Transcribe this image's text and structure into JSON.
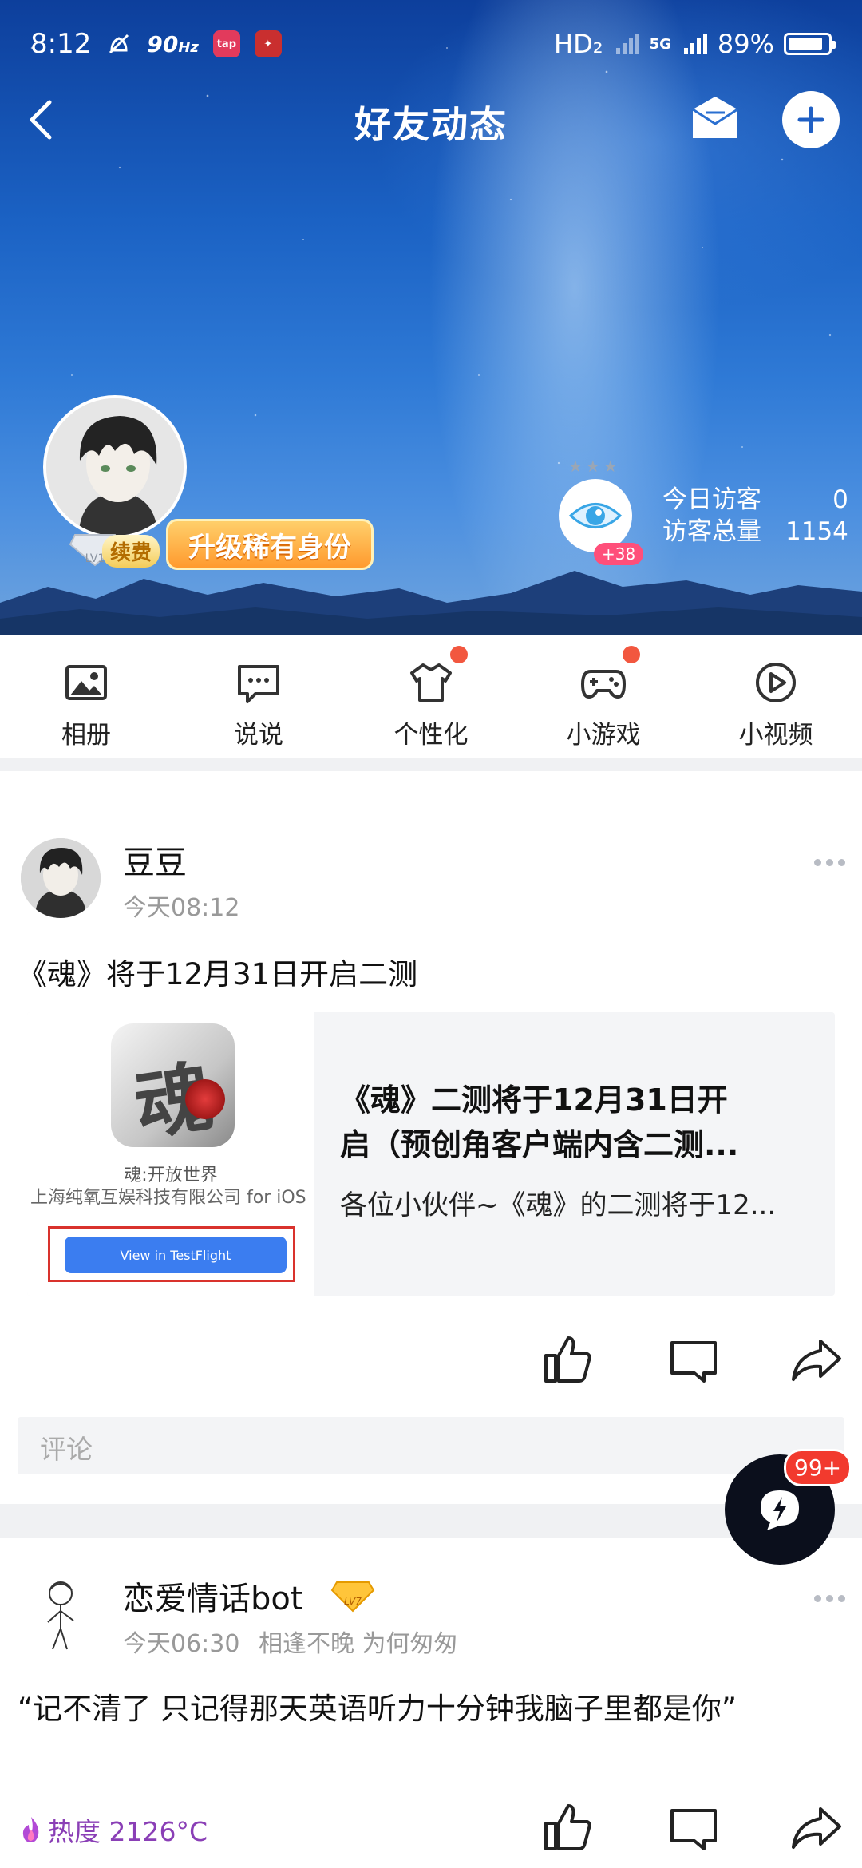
{
  "status_bar": {
    "time": "8:12",
    "refresh_rate": "90",
    "refresh_unit": "Hz",
    "network": "HD₂",
    "signal_label": "5G",
    "battery": "89%",
    "battery_level": 0.89,
    "app_icons": [
      "taptap-icon",
      "game-app-icon"
    ]
  },
  "nav": {
    "title": "好友动态",
    "icons": [
      "back-arrow-icon",
      "message-envelope-icon",
      "plus-icon"
    ]
  },
  "profile": {
    "level": "LV1",
    "renew_label": "续费",
    "upgrade_label": "升级稀有身份",
    "visitor_badge": "+38",
    "today_visitors_label": "今日访客",
    "today_visitors": "0",
    "total_visitors_label": "访客总量",
    "total_visitors": "1154"
  },
  "quick_menu": [
    {
      "label": "相册",
      "icon": "photo-album-icon",
      "dot": false
    },
    {
      "label": "说说",
      "icon": "chat-bubble-icon",
      "dot": false
    },
    {
      "label": "个性化",
      "icon": "tshirt-icon",
      "dot": true
    },
    {
      "label": "小游戏",
      "icon": "gamepad-icon",
      "dot": true
    },
    {
      "label": "小视频",
      "icon": "play-video-icon",
      "dot": false
    }
  ],
  "posts": [
    {
      "author": "豆豆",
      "time": "今天08:12",
      "text": "《魂》将于12月31日开启二测",
      "card": {
        "thumb_title": "魂:开放世界",
        "thumb_sub": "上海纯氧互娱科技有限公司 for iOS",
        "thumb_glyph": "魂",
        "thumb_button": "View in TestFlight",
        "title_line1": "《魂》二测将于12月31日开",
        "title_line2": "启（预创角客户端内含二测...",
        "desc": "各位小伙伴~《魂》的二测将于12..."
      },
      "comment_placeholder": "评论"
    },
    {
      "author": "恋爱情话bot",
      "vip_level": "LV7",
      "time": "今天06:30",
      "extra": "相逢不晚 为何匆匆",
      "text": "“记不清了 只记得那天英语听力十分钟我脑子里都是你”",
      "heat_label": "热度 2126°C"
    }
  ],
  "fab": {
    "badge": "99+",
    "icon": "flash-chat-icon"
  },
  "colors": {
    "accent_red": "#f2573f",
    "badge_red": "#f23a2e",
    "heat_purple": "#8a3fb6"
  }
}
